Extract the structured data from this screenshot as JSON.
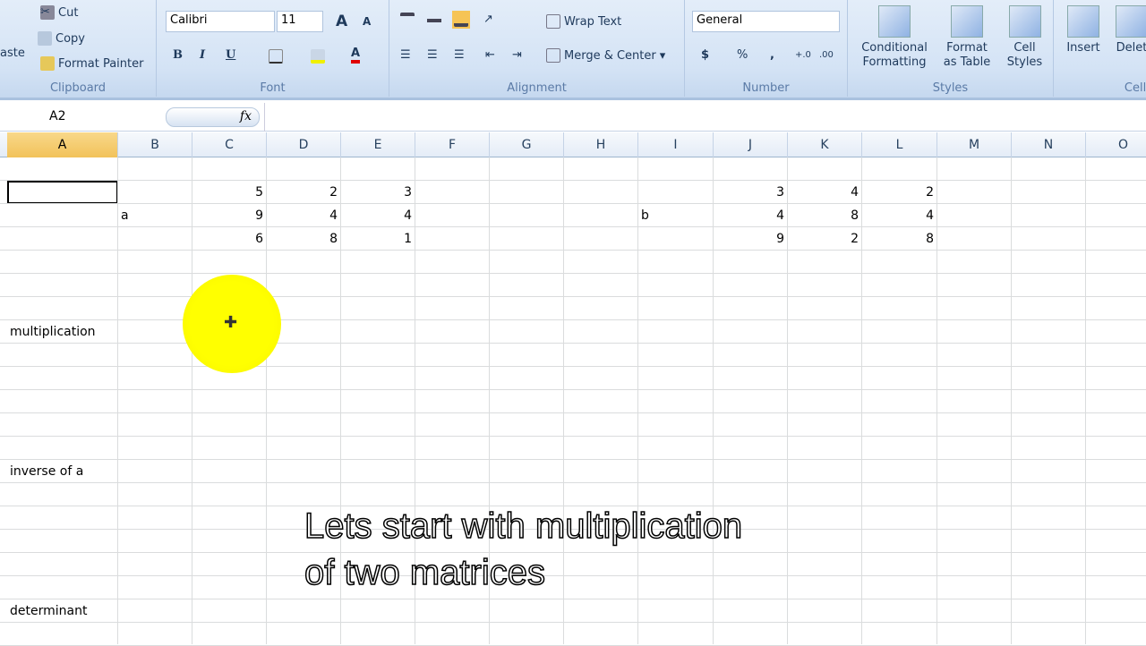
{
  "ribbon": {
    "clipboard": {
      "label": "Clipboard",
      "paste": "aste",
      "cut": "Cut",
      "copy": "Copy",
      "format_painter": "Format Painter"
    },
    "font": {
      "label": "Font",
      "font_name": "Calibri",
      "font_size": "11",
      "bold": "B",
      "italic": "I",
      "underline": "U",
      "grow": "A",
      "shrink": "A",
      "font_color": "A"
    },
    "alignment": {
      "label": "Alignment",
      "wrap_text": "Wrap Text",
      "merge_center": "Merge & Center"
    },
    "number": {
      "label": "Number",
      "format": "General",
      "currency": "$",
      "percent": "%",
      "comma": ",",
      "inc_dec": "+.0",
      "dec_dec": ".00"
    },
    "styles": {
      "label": "Styles",
      "conditional": "Conditional",
      "conditional2": "Formatting",
      "format_table": "Format",
      "format_table2": "as Table",
      "cell_styles": "Cell",
      "cell_styles2": "Styles"
    },
    "cells": {
      "label": "Cells",
      "insert": "Insert",
      "delete": "Delet"
    }
  },
  "formula_bar": {
    "name_box": "A2",
    "fx": "fx",
    "formula": ""
  },
  "columns": [
    "A",
    "B",
    "C",
    "D",
    "E",
    "F",
    "G",
    "H",
    "I",
    "J",
    "K",
    "L",
    "M",
    "N",
    "O"
  ],
  "selected_column": "A",
  "cells": {
    "b3": "a",
    "i3": "b",
    "matrix_a": [
      [
        "5",
        "2",
        "3"
      ],
      [
        "9",
        "4",
        "4"
      ],
      [
        "6",
        "8",
        "1"
      ]
    ],
    "matrix_b": [
      [
        "3",
        "4",
        "2"
      ],
      [
        "4",
        "8",
        "4"
      ],
      [
        "9",
        "2",
        "8"
      ]
    ],
    "a8": "multiplication",
    "a14": "inverse of a",
    "a20": "determinant"
  },
  "caption": {
    "line1": "Lets start with multiplication",
    "line2": "of two matrices"
  },
  "cursor_icon": "crosshair-plus-icon"
}
